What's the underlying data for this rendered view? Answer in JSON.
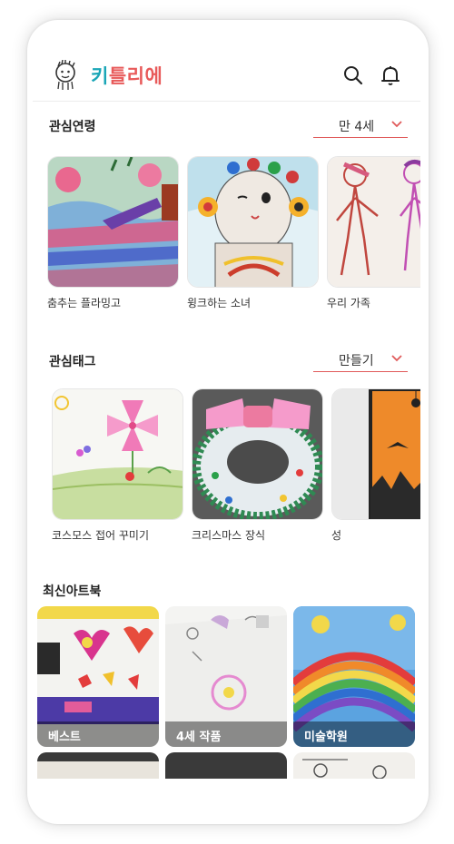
{
  "header": {
    "title_part1": "키",
    "title_part2": "틀리에",
    "search_icon": "search-icon",
    "bell_icon": "bell-icon"
  },
  "interest_age": {
    "title": "관심연령",
    "dropdown_value": "만 4세",
    "cards": [
      {
        "caption": "춤추는 플라밍고"
      },
      {
        "caption": "윙크하는 소녀"
      },
      {
        "caption": "우리 가족"
      }
    ]
  },
  "interest_tag": {
    "title": "관심태그",
    "dropdown_value": "만들기",
    "cards": [
      {
        "caption": "코스모스 접어 꾸미기"
      },
      {
        "caption": "크리스마스 장식"
      },
      {
        "caption": "성"
      }
    ]
  },
  "latest_artbook": {
    "title": "최신아트북",
    "books": [
      {
        "label": "베스트"
      },
      {
        "label": "4세 작품"
      },
      {
        "label": "미술학원"
      }
    ]
  },
  "colors": {
    "accent_red": "#e05a5a",
    "brand_teal": "#1aa6b7"
  }
}
